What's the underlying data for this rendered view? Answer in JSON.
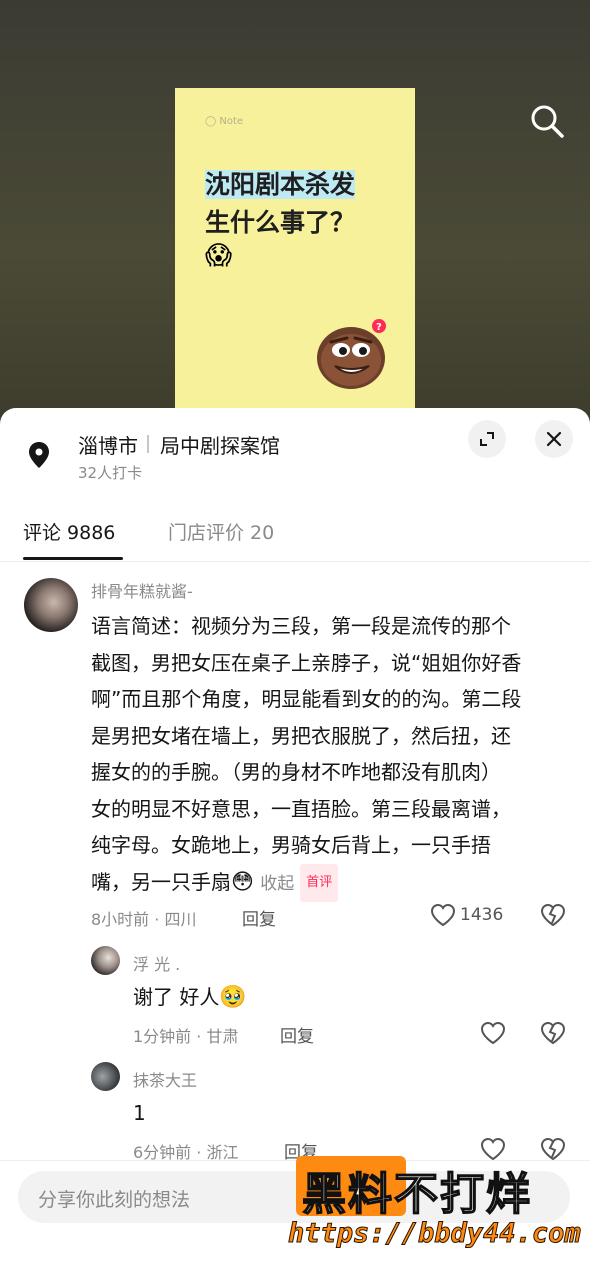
{
  "video": {
    "note_label": "Note",
    "note_title_highlight": "沈阳剧本杀发",
    "note_title_rest": "生什么事了？",
    "note_emoji": "😱"
  },
  "location": {
    "city": "淄博市",
    "shop": "局中剧探案馆",
    "checkins": "32人打卡"
  },
  "tabs": [
    {
      "label": "评论 9886",
      "active": true
    },
    {
      "label": "门店评价 20",
      "active": false
    }
  ],
  "comments": [
    {
      "username": "排骨年糕就酱-",
      "lines": [
        "语言简述：视频分为三段，第一段是流传的那个",
        "截图，男把女压在桌子上亲脖子，说“姐姐你好香",
        "啊”而且那个角度，明显能看到女的的沟。第二段",
        "是男把女堵在墙上，男把衣服脱了，然后扭，还",
        "握女的的手腕。（男的身材不咋地都没有肌肉）",
        "女的明显不好意思，一直捂脸。第三段最离谱，",
        "纯字母。女跪地上，男骑女后背上，一只手捂",
        "嘴，另一只手扇"
      ],
      "trailing_emoji": "😳",
      "collapse_label": "收起",
      "badge": "首评",
      "meta": "8小时前 · 四川",
      "reply_label": "回复",
      "likes": "1436"
    },
    {
      "username": "浮 光 .",
      "text": "谢了 好人",
      "trailing_emoji": "🥹",
      "meta": "1分钟前 · 甘肃",
      "reply_label": "回复"
    },
    {
      "username": "抹茶大王",
      "text": "1",
      "meta": "6分钟前 · 浙江",
      "reply_label": "回复"
    }
  ],
  "input": {
    "placeholder": "分享你此刻的想法"
  },
  "watermark": {
    "text": "黑料不打烊",
    "url": "https://bbdy44.com"
  },
  "colors": {
    "accent": "#fe2c55",
    "note_bg": "#f8f19c",
    "watermark": "#ff8a12"
  },
  "icons": [
    "search-icon",
    "location-pin-icon",
    "expand-icon",
    "close-icon",
    "heart-icon",
    "dislike-heart-icon"
  ]
}
